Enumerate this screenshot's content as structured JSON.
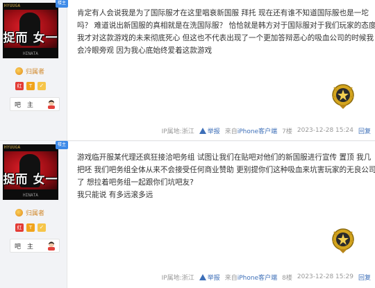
{
  "posts": [
    {
      "user": {
        "avatar_top_text": "HYUUGA",
        "avatar_kanji": "捉而 女一",
        "avatar_bottom_text": "HINATA",
        "louzhu_label": "楼主",
        "belong_label": "归属者",
        "bar_name": "吧 主",
        "badges": [
          "红",
          "T",
          "✓"
        ]
      },
      "content_lines": [
        "肯定有人会说我是为了国际服才在这里唱衰新国服 拜托 现在还有谁不知道国际服也是一坨",
        "吗？ 难道说出新国服的真相就是在洗国际服？ 恰恰就是韩方对于国际服对于我们玩家的态度",
        "我才对这款游戏的未来彻底死心 但这也不代表出现了一个更加答辩恶心的吸血公司的时候我",
        "会冷眼旁观 因为我心底始终爱着这款游戏"
      ],
      "footer": {
        "ip": "IP属地:浙江",
        "report": "举报",
        "source_prefix": "来自",
        "source": "iPhone客户端",
        "floor": "7楼",
        "time": "2023-12-28 15:24",
        "reply": "回复"
      }
    },
    {
      "user": {
        "avatar_top_text": "HYUUGA",
        "avatar_kanji": "捉而 女一",
        "avatar_bottom_text": "HINATA",
        "louzhu_label": "楼主",
        "belong_label": "归属者",
        "bar_name": "吧 主",
        "badges": [
          "红",
          "T",
          "✓"
        ]
      },
      "content_lines": [
        "游戏临开服某代理还疯狂接洽吧务组 试图让我们在贴吧对他们的新国服进行宣传 置顶 我几",
        "把呸 我们吧务组全体从来不会接受任何商业赞助 更别提你们这种吸血来坑害玩家的无良公司",
        "了 想拉着吧务组一起跟你们坑吧友?",
        "我只能说 有多远滚多远"
      ],
      "footer": {
        "ip": "IP属地:浙江",
        "report": "举报",
        "source_prefix": "来自",
        "source": "iPhone客户端",
        "floor": "8楼",
        "time": "2023-12-28 15:29",
        "reply": "回复"
      }
    }
  ]
}
